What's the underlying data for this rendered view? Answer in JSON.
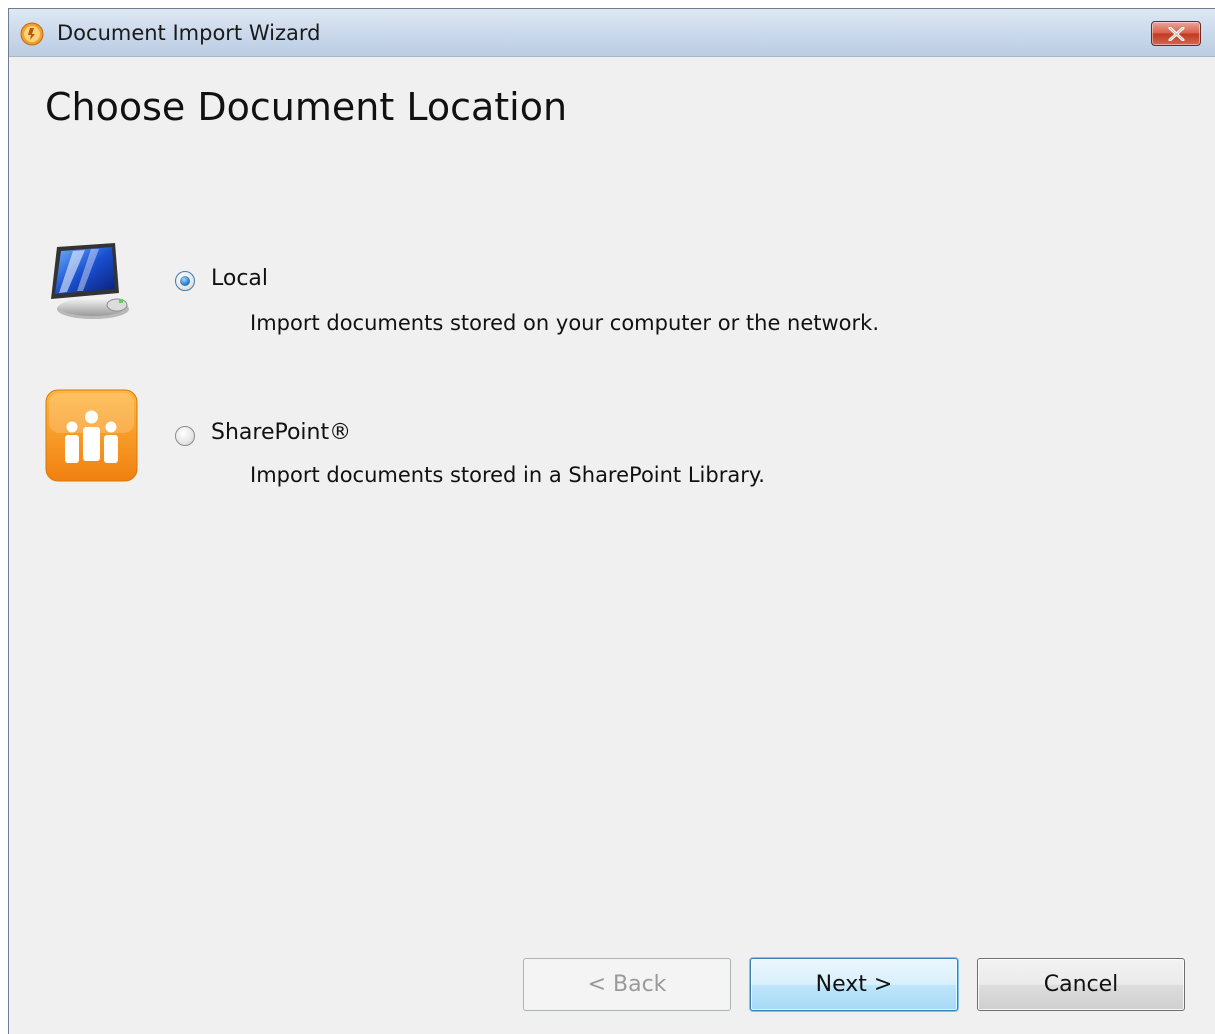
{
  "window": {
    "title": "Document Import Wizard",
    "close_label": "✕"
  },
  "page": {
    "heading": "Choose Document Location"
  },
  "options": [
    {
      "label": "Local",
      "description": "Import documents stored on your computer or the network.",
      "selected": true,
      "icon": "computer-icon"
    },
    {
      "label": "SharePoint®",
      "description": "Import documents stored in a SharePoint Library.",
      "selected": false,
      "icon": "sharepoint-icon"
    }
  ],
  "buttons": {
    "back": "< Back",
    "next": "Next >",
    "cancel": "Cancel"
  },
  "colors": {
    "accent": "#3c7fb1",
    "sharepoint_orange": "#f39c1f",
    "close_red": "#c13a22"
  }
}
